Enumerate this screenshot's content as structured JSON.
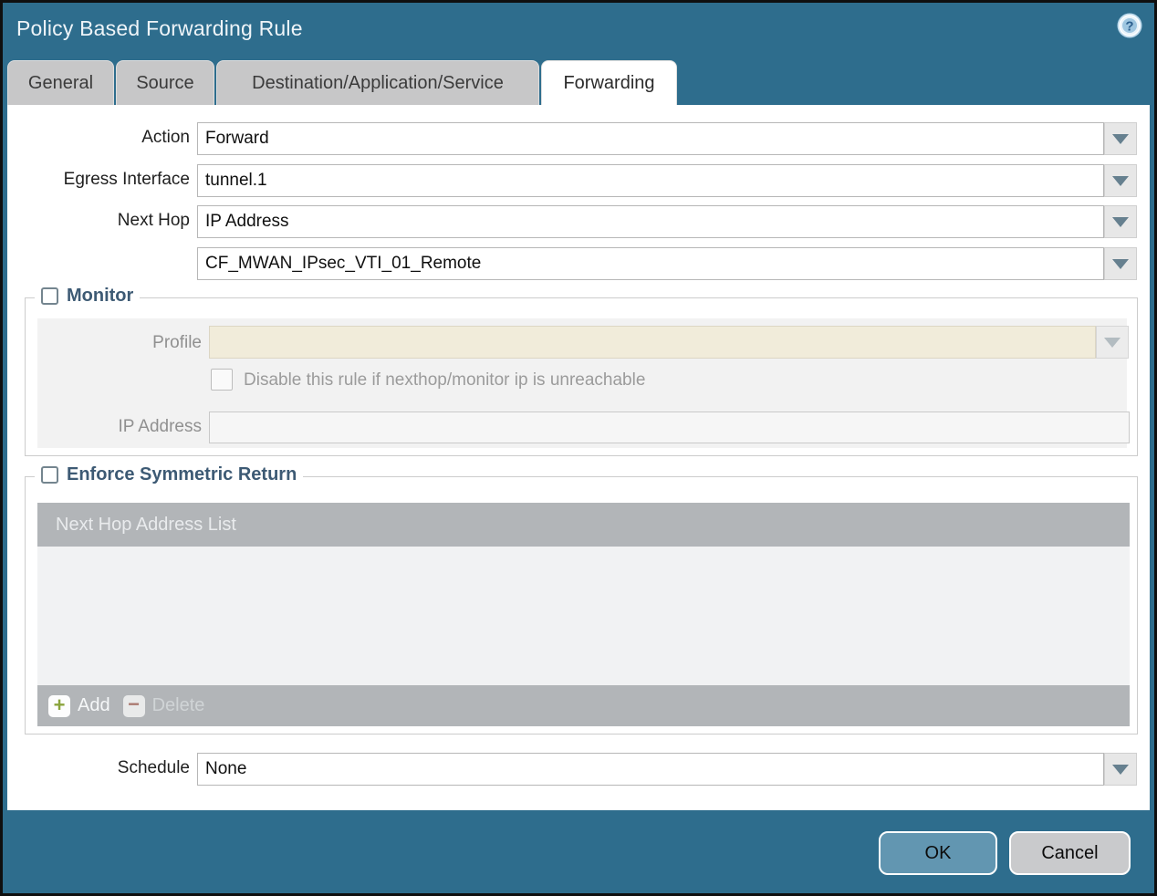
{
  "dialog": {
    "title": "Policy Based Forwarding Rule"
  },
  "tabs": [
    {
      "label": "General",
      "active": false
    },
    {
      "label": "Source",
      "active": false
    },
    {
      "label": "Destination/Application/Service",
      "active": false
    },
    {
      "label": "Forwarding",
      "active": true
    }
  ],
  "form": {
    "action": {
      "label": "Action",
      "value": "Forward"
    },
    "egress": {
      "label": "Egress Interface",
      "value": "tunnel.1"
    },
    "next_hop": {
      "label": "Next Hop",
      "type_value": "IP Address",
      "address_value": "CF_MWAN_IPsec_VTI_01_Remote"
    },
    "monitor": {
      "label": "Monitor",
      "checked": false,
      "profile": {
        "label": "Profile",
        "value": ""
      },
      "disable": {
        "label": "Disable this rule if nexthop/monitor ip is unreachable",
        "checked": false
      },
      "ip": {
        "label": "IP Address",
        "value": ""
      }
    },
    "enforce": {
      "label": "Enforce Symmetric Return",
      "checked": false,
      "table": {
        "header": "Next Hop Address List",
        "rows": [],
        "add_label": "Add",
        "delete_label": "Delete"
      }
    },
    "schedule": {
      "label": "Schedule",
      "value": "None"
    }
  },
  "footer": {
    "ok": "OK",
    "cancel": "Cancel"
  },
  "icons": {
    "help": "question-mark-circle",
    "dropdown": "chevron-down",
    "add": "plus",
    "delete": "minus"
  },
  "colors": {
    "titlebar_teal": "#2e6d8d",
    "tab_inactive": "#c7c7c8",
    "tab_active": "#ffffff",
    "fieldset_legend_text": "#3d5a74",
    "disabled_profile_field": "#f1ecda",
    "table_header_gray": "#b2b5b8",
    "table_body_gray": "#f1f2f3",
    "ok_button": "#6296b1",
    "cancel_button": "#c9cacc",
    "add_plus_green": "#8aa43c",
    "delete_minus_red": "#ab7a71"
  }
}
